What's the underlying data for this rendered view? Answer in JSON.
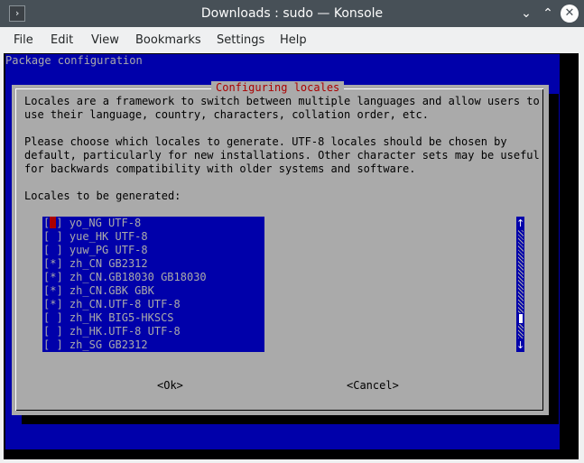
{
  "window": {
    "title": "Downloads : sudo — Konsole",
    "minimize_glyph": "⌄",
    "maximize_glyph": "⌃",
    "close_glyph": "✕",
    "app_icon_glyph": "›"
  },
  "menu": {
    "items": [
      "File",
      "Edit",
      "View",
      "Bookmarks",
      "Settings",
      "Help"
    ]
  },
  "terminal": {
    "header": "Package configuration",
    "dialog": {
      "title": "Configuring locales",
      "paragraph1": [
        "Locales are a framework to switch between multiple languages and allow users to",
        "use their language, country, characters, collation order, etc."
      ],
      "paragraph2": [
        "Please choose which locales to generate. UTF-8 locales should be chosen by",
        "default, particularly for new installations. Other character sets may be useful",
        "for backwards compatibility with older systems and software."
      ],
      "list_label": "Locales to be generated:",
      "locales": [
        {
          "mark": "[ ]",
          "name": "yo_NG UTF-8",
          "checked": false,
          "focused": true
        },
        {
          "mark": "[ ]",
          "name": "yue_HK UTF-8",
          "checked": false
        },
        {
          "mark": "[ ]",
          "name": "yuw_PG UTF-8",
          "checked": false
        },
        {
          "mark": "[*]",
          "name": "zh_CN GB2312",
          "checked": true
        },
        {
          "mark": "[*]",
          "name": "zh_CN.GB18030 GB18030",
          "checked": true
        },
        {
          "mark": "[*]",
          "name": "zh_CN.GBK GBK",
          "checked": true
        },
        {
          "mark": "[*]",
          "name": "zh_CN.UTF-8 UTF-8",
          "checked": true
        },
        {
          "mark": "[ ]",
          "name": "zh_HK BIG5-HKSCS",
          "checked": false
        },
        {
          "mark": "[ ]",
          "name": "zh_HK.UTF-8 UTF-8",
          "checked": false
        },
        {
          "mark": "[ ]",
          "name": "zh_SG GB2312",
          "checked": false
        }
      ],
      "scroll_up": "↑",
      "scroll_down": "↓",
      "ok_button": "<Ok>",
      "cancel_button": "<Cancel>"
    }
  }
}
